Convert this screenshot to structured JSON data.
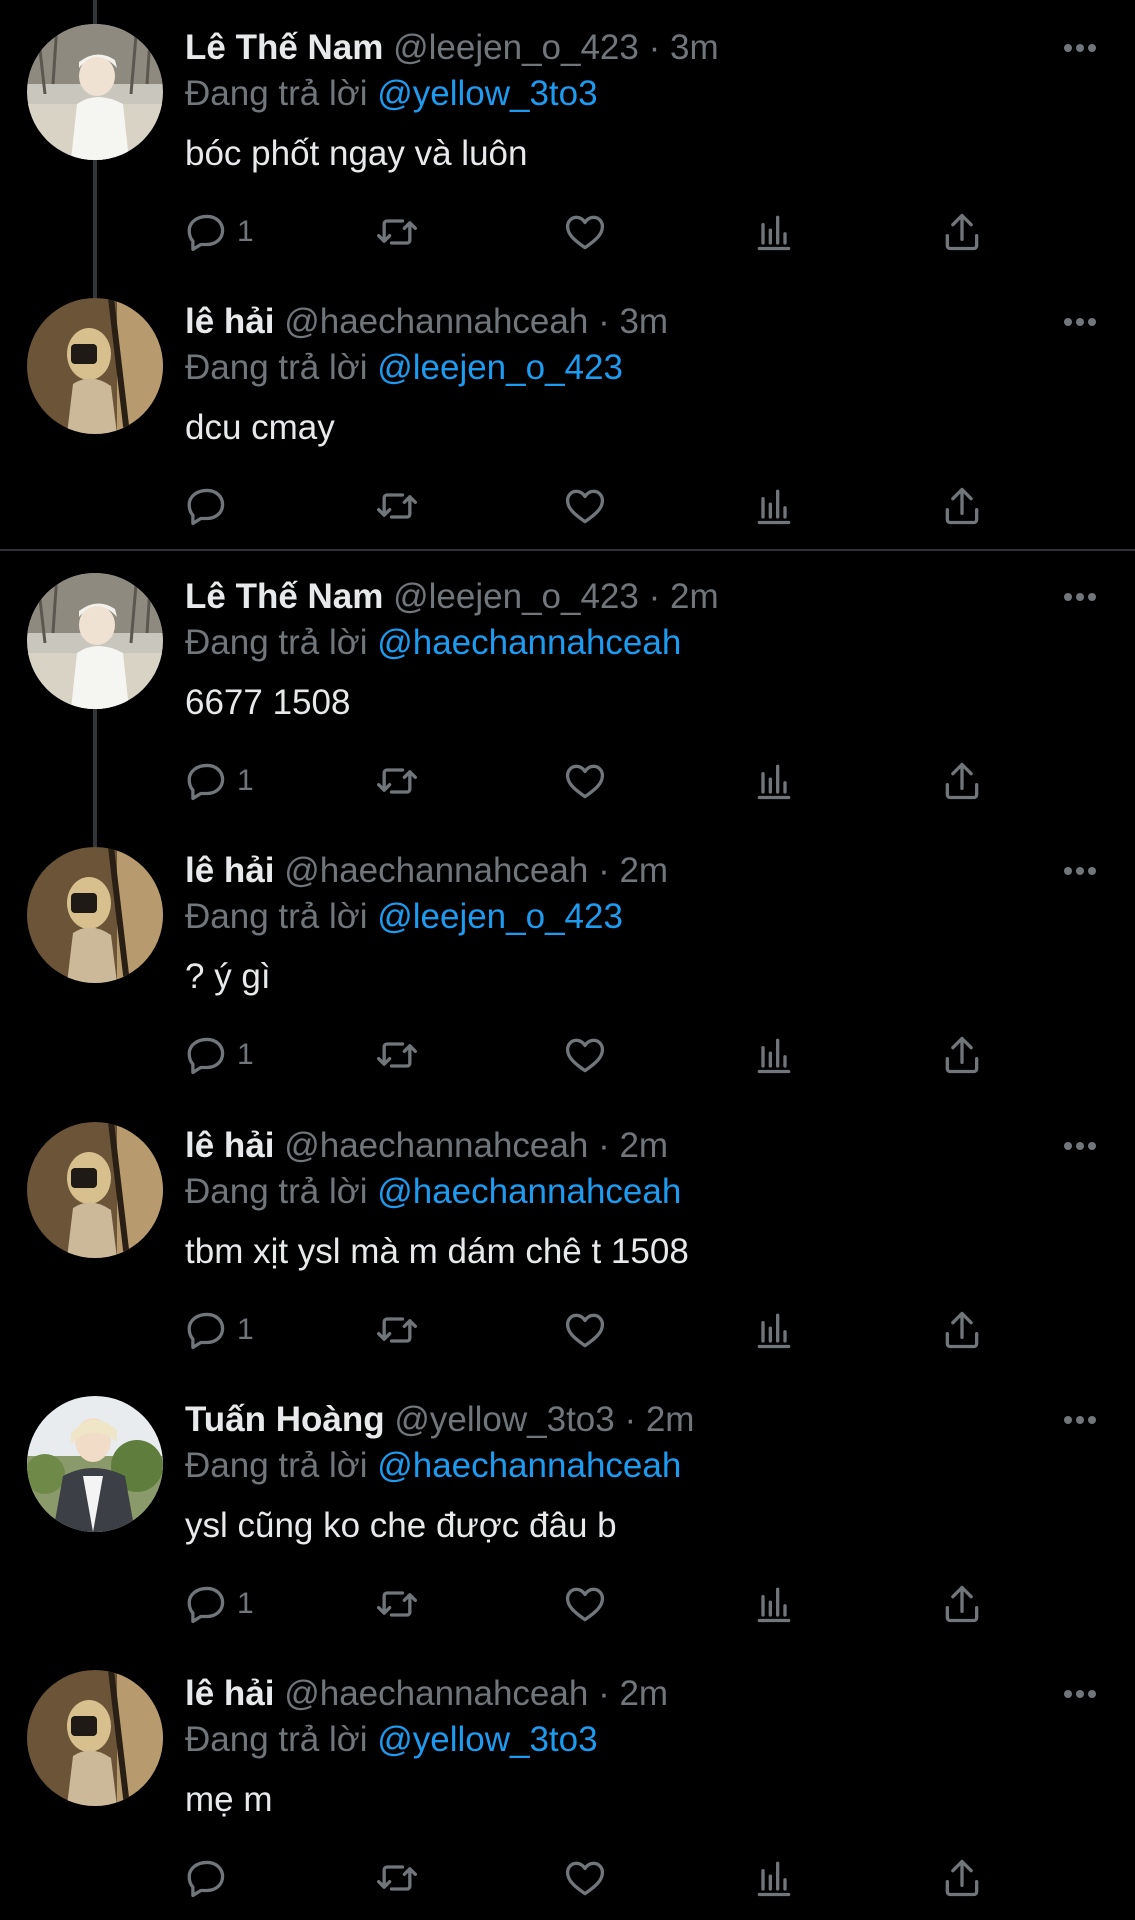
{
  "tweets": [
    {
      "name": "Lê Thế Nam",
      "handle": "@leejen_o_423",
      "dot": "·",
      "time": "3m",
      "reply_prefix": "Đang trả lời",
      "reply_to": "@yellow_3to3",
      "text": "bóc phốt ngay và luôn",
      "reply_count": "1",
      "avatar": "avatar-lethenam"
    },
    {
      "name": "lê hải",
      "handle": "@haechannahceah",
      "dot": "·",
      "time": "3m",
      "reply_prefix": "Đang trả lời",
      "reply_to": "@leejen_o_423",
      "text": "dcu cmay",
      "reply_count": "",
      "avatar": "avatar-lehai"
    },
    {
      "name": "Lê Thế Nam",
      "handle": "@leejen_o_423",
      "dot": "·",
      "time": "2m",
      "reply_prefix": "Đang trả lời",
      "reply_to": "@haechannahceah",
      "text": "6677 1508",
      "reply_count": "1",
      "avatar": "avatar-lethenam"
    },
    {
      "name": "lê hải",
      "handle": "@haechannahceah",
      "dot": "·",
      "time": "2m",
      "reply_prefix": "Đang trả lời",
      "reply_to": "@leejen_o_423",
      "text": "? ý gì",
      "reply_count": "1",
      "avatar": "avatar-lehai"
    },
    {
      "name": "lê hải",
      "handle": "@haechannahceah",
      "dot": "·",
      "time": "2m",
      "reply_prefix": "Đang trả lời",
      "reply_to": "@haechannahceah",
      "text": "tbm xịt ysl mà m dám chê t 1508",
      "reply_count": "1",
      "avatar": "avatar-lehai"
    },
    {
      "name": "Tuấn Hoàng",
      "handle": "@yellow_3to3",
      "dot": "·",
      "time": "2m",
      "reply_prefix": "Đang trả lời",
      "reply_to": "@haechannahceah",
      "text": "ysl cũng ko che được đâu b",
      "reply_count": "1",
      "avatar": "avatar-tuanhoang"
    },
    {
      "name": "lê hải",
      "handle": "@haechannahceah",
      "dot": "·",
      "time": "2m",
      "reply_prefix": "Đang trả lời",
      "reply_to": "@yellow_3to3",
      "text": "mẹ m",
      "reply_count": "",
      "avatar": "avatar-lehai"
    }
  ],
  "icons": {
    "reply": "reply-icon",
    "retweet": "retweet-icon",
    "like": "like-icon",
    "analytics": "analytics-icon",
    "share": "share-icon",
    "more": "more-icon"
  },
  "colors": {
    "background": "#000000",
    "text": "#e7e9ea",
    "muted": "#71767b",
    "mention": "#1d9bf0",
    "divider": "#2f3336"
  }
}
